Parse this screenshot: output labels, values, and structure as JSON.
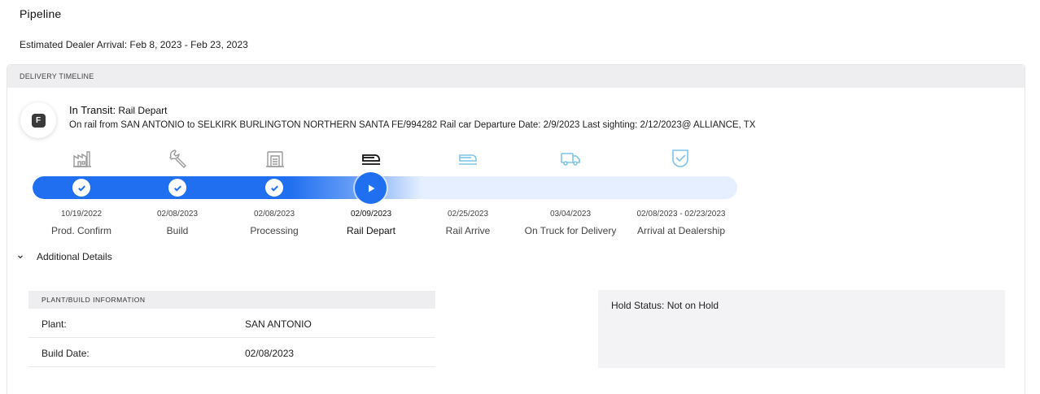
{
  "page": {
    "title": "Pipeline",
    "eta_text": "Estimated Dealer Arrival: Feb 8, 2023 - Feb 23, 2023"
  },
  "timeline": {
    "header": "DELIVERY TIMELINE",
    "badge_letter": "F",
    "status_prefix": "In Transit:",
    "status_value": "Rail Depart",
    "status_detail": "On rail from SAN ANTONIO to SELKIRK BURLINGTON NORTHERN SANTA FE/994282 Rail car Departure Date: 2/9/2023 Last sighting: 2/12/2023@ ALLIANCE, TX",
    "current_stage_index": 3,
    "colors": {
      "accent": "#1f6ff0",
      "track_bg": "#e5efff",
      "future_icon": "#7fc4e8",
      "done_icon": "#9a9a9a",
      "current_icon": "#111111"
    },
    "stages": [
      {
        "date": "10/19/2022",
        "label": "Prod. Confirm",
        "icon": "factory-icon",
        "state": "done"
      },
      {
        "date": "02/08/2023",
        "label": "Build",
        "icon": "wrench-icon",
        "state": "done"
      },
      {
        "date": "02/08/2023",
        "label": "Processing",
        "icon": "processing-icon",
        "state": "done"
      },
      {
        "date": "02/09/2023",
        "label": "Rail Depart",
        "icon": "train-icon",
        "state": "current"
      },
      {
        "date": "02/25/2023",
        "label": "Rail Arrive",
        "icon": "train-icon",
        "state": "future"
      },
      {
        "date": "03/04/2023",
        "label": "On Truck for Delivery",
        "icon": "truck-icon",
        "state": "future"
      },
      {
        "date": "02/08/2023 - 02/23/2023",
        "label": "Arrival at Dealership",
        "icon": "shield-check-icon",
        "state": "future"
      }
    ]
  },
  "details": {
    "toggle_label": "Additional Details",
    "plant_header": "PLANT/BUILD INFORMATION",
    "rows": [
      {
        "key": "Plant:",
        "value": "SAN ANTONIO"
      },
      {
        "key": "Build Date:",
        "value": "02/08/2023"
      }
    ],
    "hold_status": "Hold Status: Not on Hold"
  }
}
